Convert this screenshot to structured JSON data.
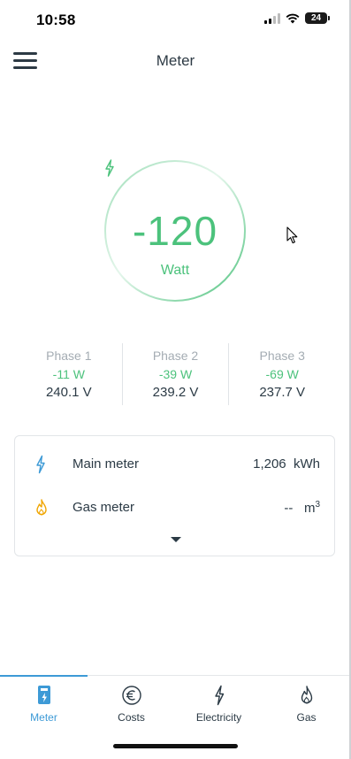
{
  "status_bar": {
    "time": "10:58",
    "battery": "24"
  },
  "header": {
    "title": "Meter"
  },
  "gauge": {
    "value": "-120",
    "unit": "Watt",
    "color": "#4cc27c"
  },
  "phases": [
    {
      "name": "Phase 1",
      "power": "-11 W",
      "voltage": "240.1 V"
    },
    {
      "name": "Phase 2",
      "power": "-39 W",
      "voltage": "239.2 V"
    },
    {
      "name": "Phase 3",
      "power": "-69 W",
      "voltage": "237.7 V"
    }
  ],
  "meters": {
    "main": {
      "label": "Main meter",
      "value": "1,206",
      "unit": "kWh",
      "icon": "bolt-icon"
    },
    "gas": {
      "label": "Gas meter",
      "value": "--",
      "unit": "m",
      "unit_sup": "3",
      "icon": "flame-icon"
    }
  },
  "tabs": [
    {
      "label": "Meter",
      "icon": "meter-icon",
      "active": true
    },
    {
      "label": "Costs",
      "icon": "euro-icon",
      "active": false
    },
    {
      "label": "Electricity",
      "icon": "bolt-icon",
      "active": false
    },
    {
      "label": "Gas",
      "icon": "flame-icon",
      "active": false
    }
  ],
  "colors": {
    "accent": "#3d9ad6",
    "positive": "#4cc27c",
    "gas": "#f0a500"
  }
}
